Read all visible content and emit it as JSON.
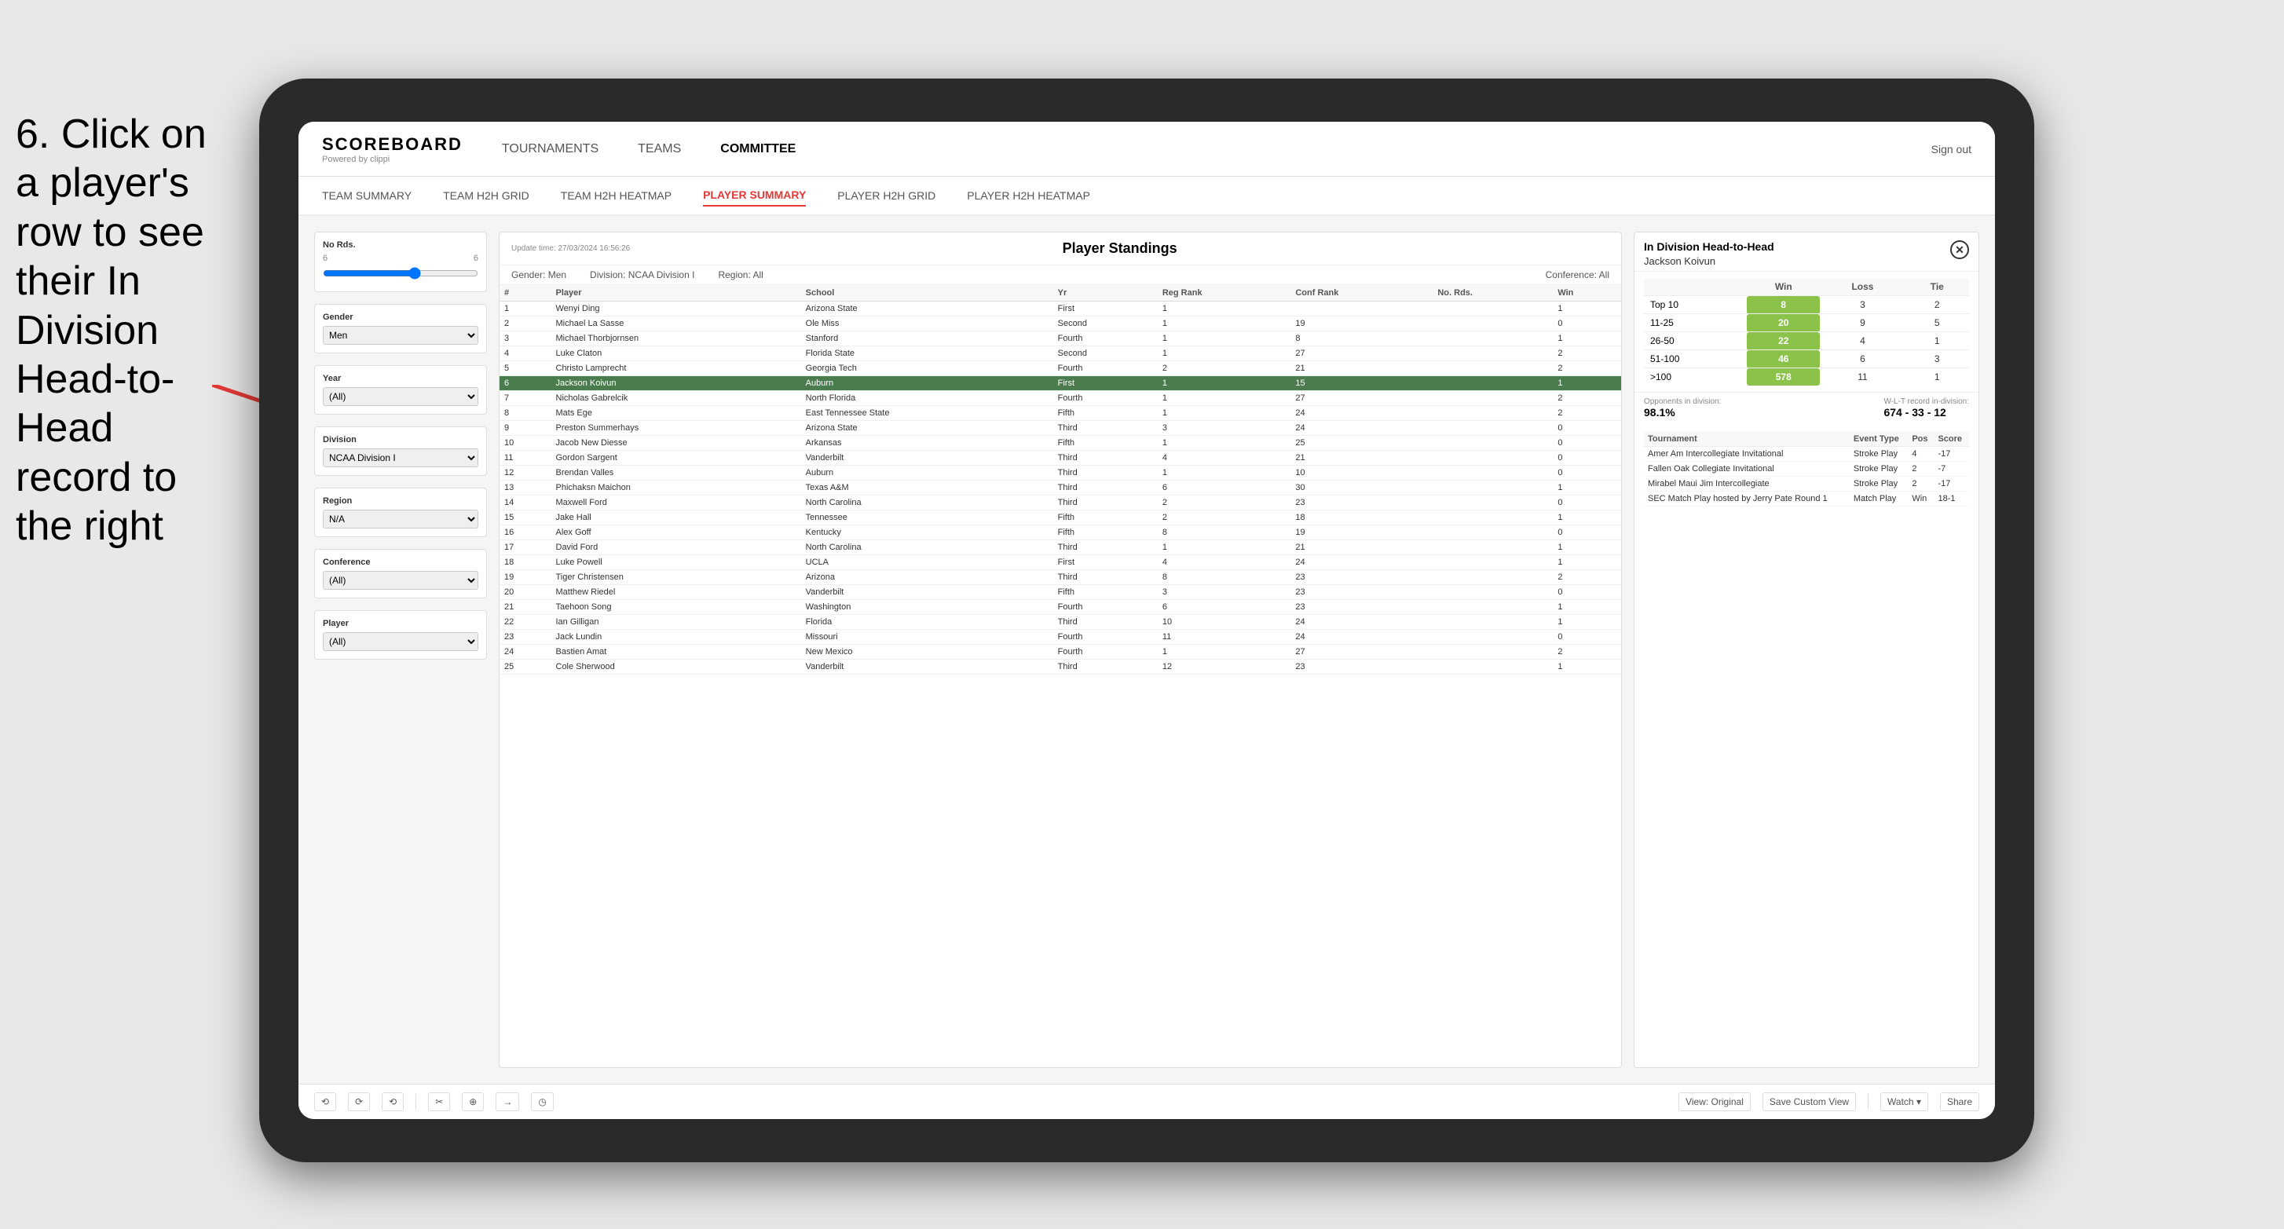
{
  "instruction": {
    "text": "6. Click on a player's row to see their In Division Head-to-Head record to the right"
  },
  "nav": {
    "logo": "SCOREBOARD",
    "logo_sub": "Powered by clippi",
    "links": [
      "TOURNAMENTS",
      "TEAMS",
      "COMMITTEE"
    ],
    "sign_out": "Sign out"
  },
  "sub_nav": {
    "links": [
      "TEAM SUMMARY",
      "TEAM H2H GRID",
      "TEAM H2H HEATMAP",
      "PLAYER SUMMARY",
      "PLAYER H2H GRID",
      "PLAYER H2H HEATMAP"
    ],
    "active": "PLAYER SUMMARY"
  },
  "standings": {
    "title": "Player Standings",
    "update_time": "Update time:",
    "update_date": "27/03/2024 16:56:26",
    "filters": {
      "gender_label": "Gender:",
      "gender_val": "Men",
      "division_label": "Division:",
      "division_val": "NCAA Division I",
      "region_label": "Region:",
      "region_val": "All",
      "conference_label": "Conference:",
      "conference_val": "All"
    },
    "columns": [
      "#",
      "Player",
      "School",
      "Yr",
      "Reg Rank",
      "Conf Rank",
      "No. Rds.",
      "Win"
    ],
    "rows": [
      {
        "num": 1,
        "player": "Wenyi Ding",
        "school": "Arizona State",
        "yr": "First",
        "reg": 1,
        "conf": "",
        "rds": "",
        "win": 1
      },
      {
        "num": 2,
        "player": "Michael La Sasse",
        "school": "Ole Miss",
        "yr": "Second",
        "reg": 1,
        "conf": 19,
        "rds": "",
        "win": 0
      },
      {
        "num": 3,
        "player": "Michael Thorbjornsen",
        "school": "Stanford",
        "yr": "Fourth",
        "reg": 1,
        "conf": 8,
        "rds": "",
        "win": 1
      },
      {
        "num": 4,
        "player": "Luke Claton",
        "school": "Florida State",
        "yr": "Second",
        "reg": 1,
        "conf": 27,
        "rds": "",
        "win": 2
      },
      {
        "num": 5,
        "player": "Christo Lamprecht",
        "school": "Georgia Tech",
        "yr": "Fourth",
        "reg": 2,
        "conf": 21,
        "rds": "",
        "win": 2
      },
      {
        "num": 6,
        "player": "Jackson Koivun",
        "school": "Auburn",
        "yr": "First",
        "reg": 1,
        "conf": 15,
        "rds": "",
        "win": 1,
        "selected": true
      },
      {
        "num": 7,
        "player": "Nicholas Gabrelcik",
        "school": "North Florida",
        "yr": "Fourth",
        "reg": 1,
        "conf": 27,
        "rds": "",
        "win": 2
      },
      {
        "num": 8,
        "player": "Mats Ege",
        "school": "East Tennessee State",
        "yr": "Fifth",
        "reg": 1,
        "conf": 24,
        "rds": "",
        "win": 2
      },
      {
        "num": 9,
        "player": "Preston Summerhays",
        "school": "Arizona State",
        "yr": "Third",
        "reg": 3,
        "conf": 24,
        "rds": "",
        "win": 0
      },
      {
        "num": 10,
        "player": "Jacob New Diesse",
        "school": "Arkansas",
        "yr": "Fifth",
        "reg": 1,
        "conf": 25,
        "rds": "",
        "win": 0
      },
      {
        "num": 11,
        "player": "Gordon Sargent",
        "school": "Vanderbilt",
        "yr": "Third",
        "reg": 4,
        "conf": 21,
        "rds": "",
        "win": 0
      },
      {
        "num": 12,
        "player": "Brendan Valles",
        "school": "Auburn",
        "yr": "Third",
        "reg": 1,
        "conf": 10,
        "rds": "",
        "win": 0
      },
      {
        "num": 13,
        "player": "Phichaksn Maichon",
        "school": "Texas A&M",
        "yr": "Third",
        "reg": 6,
        "conf": 30,
        "rds": "",
        "win": 1
      },
      {
        "num": 14,
        "player": "Maxwell Ford",
        "school": "North Carolina",
        "yr": "Third",
        "reg": 2,
        "conf": 23,
        "rds": "",
        "win": 0
      },
      {
        "num": 15,
        "player": "Jake Hall",
        "school": "Tennessee",
        "yr": "Fifth",
        "reg": 2,
        "conf": 18,
        "rds": "",
        "win": 1
      },
      {
        "num": 16,
        "player": "Alex Goff",
        "school": "Kentucky",
        "yr": "Fifth",
        "reg": 8,
        "conf": 19,
        "rds": "",
        "win": 0
      },
      {
        "num": 17,
        "player": "David Ford",
        "school": "North Carolina",
        "yr": "Third",
        "reg": 1,
        "conf": 21,
        "rds": "",
        "win": 1
      },
      {
        "num": 18,
        "player": "Luke Powell",
        "school": "UCLA",
        "yr": "First",
        "reg": 4,
        "conf": 24,
        "rds": "",
        "win": 1
      },
      {
        "num": 19,
        "player": "Tiger Christensen",
        "school": "Arizona",
        "yr": "Third",
        "reg": 8,
        "conf": 23,
        "rds": "",
        "win": 2
      },
      {
        "num": 20,
        "player": "Matthew Riedel",
        "school": "Vanderbilt",
        "yr": "Fifth",
        "reg": 3,
        "conf": 23,
        "rds": "",
        "win": 0
      },
      {
        "num": 21,
        "player": "Taehoon Song",
        "school": "Washington",
        "yr": "Fourth",
        "reg": 6,
        "conf": 23,
        "rds": "",
        "win": 1
      },
      {
        "num": 22,
        "player": "Ian Gilligan",
        "school": "Florida",
        "yr": "Third",
        "reg": 10,
        "conf": 24,
        "rds": "",
        "win": 1
      },
      {
        "num": 23,
        "player": "Jack Lundin",
        "school": "Missouri",
        "yr": "Fourth",
        "reg": 11,
        "conf": 24,
        "rds": "",
        "win": 0
      },
      {
        "num": 24,
        "player": "Bastien Amat",
        "school": "New Mexico",
        "yr": "Fourth",
        "reg": 1,
        "conf": 27,
        "rds": "",
        "win": 2
      },
      {
        "num": 25,
        "player": "Cole Sherwood",
        "school": "Vanderbilt",
        "yr": "Third",
        "reg": 12,
        "conf": 23,
        "rds": "",
        "win": 1
      }
    ]
  },
  "sidebar": {
    "no_rds_label": "No Rds.",
    "slider_min": "6",
    "slider_max": "6",
    "gender_label": "Gender",
    "gender_val": "Men",
    "year_label": "Year",
    "year_val": "(All)",
    "division_label": "Division",
    "division_val": "NCAA Division I",
    "region_label": "Region",
    "region_val": "N/A",
    "conference_label": "Conference",
    "conference_val": "(All)",
    "player_label": "Player",
    "player_val": "(All)"
  },
  "h2h": {
    "title": "In Division Head-to-Head",
    "player": "Jackson Koivun",
    "col_win": "Win",
    "col_loss": "Loss",
    "col_tie": "Tie",
    "rows": [
      {
        "range": "Top 10",
        "win": 8,
        "loss": 3,
        "tie": 2
      },
      {
        "range": "11-25",
        "win": 20,
        "loss": 9,
        "tie": 5
      },
      {
        "range": "26-50",
        "win": 22,
        "loss": 4,
        "tie": 1
      },
      {
        "range": "51-100",
        "win": 46,
        "loss": 6,
        "tie": 3
      },
      {
        "range": ">100",
        "win": 578,
        "loss": 11,
        "tie": 1
      }
    ],
    "opponents_label": "Opponents in division:",
    "opponents_val": "98.1%",
    "record_label": "W-L-T record in-division:",
    "record_val": "674 - 33 - 12",
    "tournament_columns": [
      "Tournament",
      "Event Type",
      "Pos",
      "Score"
    ],
    "tournaments": [
      {
        "name": "Amer Am Intercollegiate Invitational",
        "type": "Stroke Play",
        "pos": 4,
        "score": "-17"
      },
      {
        "name": "Fallen Oak Collegiate Invitational",
        "type": "Stroke Play",
        "pos": 2,
        "score": "-7"
      },
      {
        "name": "Mirabel Maui Jim Intercollegiate",
        "type": "Stroke Play",
        "pos": 2,
        "score": "-17"
      },
      {
        "name": "SEC Match Play hosted by Jerry Pate Round 1",
        "type": "Match Play",
        "pos": "Win",
        "score": "18-1"
      }
    ]
  },
  "toolbar": {
    "buttons": [
      "⟲",
      "⟳",
      "⟲",
      "✂",
      "⊕",
      "→",
      "◷"
    ],
    "view_original": "View: Original",
    "save_custom": "Save Custom View",
    "watch": "Watch ▾",
    "share": "Share"
  }
}
